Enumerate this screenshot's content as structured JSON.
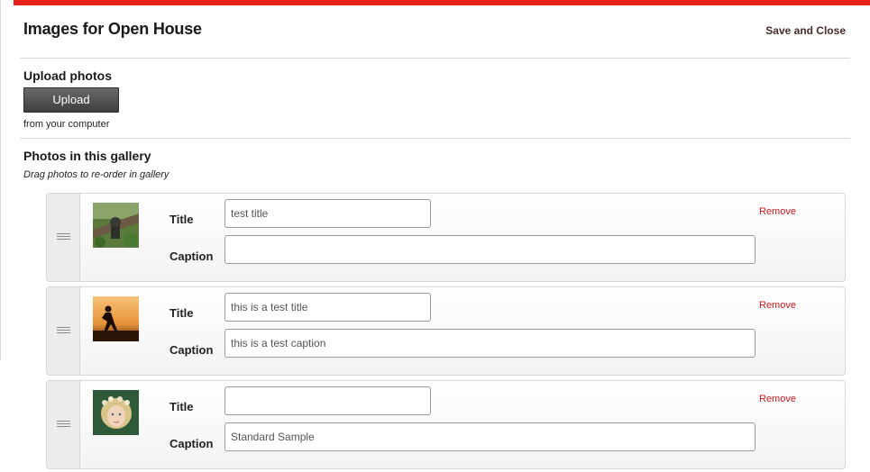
{
  "header": {
    "title": "Images for Open House",
    "save_close_label": "Save and Close"
  },
  "upload": {
    "section_title": "Upload photos",
    "button_label": "Upload",
    "note": "from your computer"
  },
  "gallery": {
    "section_title": "Photos in this gallery",
    "hint": "Drag photos to re-order in gallery",
    "title_label": "Title",
    "caption_label": "Caption",
    "remove_label": "Remove",
    "photos": [
      {
        "title": "test title",
        "caption": ""
      },
      {
        "title": "this is a test title",
        "caption": "this is a test caption"
      },
      {
        "title": "",
        "caption": "Standard Sample"
      }
    ]
  },
  "colors": {
    "accent_bar": "#e8231e",
    "remove_link": "#c8161d",
    "upload_button": "#4a4a4a"
  }
}
